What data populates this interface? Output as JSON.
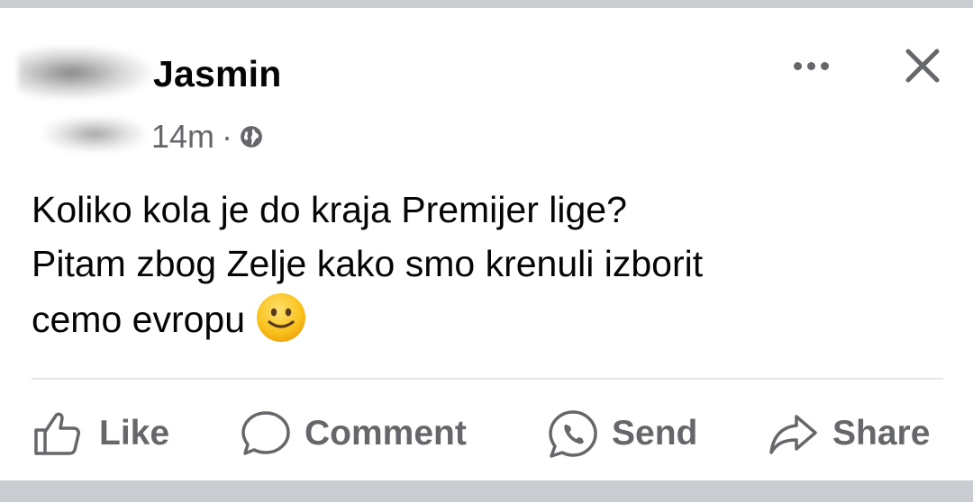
{
  "post": {
    "author_name": "Jasmin",
    "time": "14m",
    "separator": "·",
    "privacy_icon": "globe-icon",
    "text_lines": [
      "Koliko kola je do kraja Premijer lige?",
      "Pitam zbog Zelje kako smo krenuli izborit",
      "cemo evropu"
    ],
    "emoji": "slightly-smiling-face-icon"
  },
  "header_actions": {
    "more_icon": "more-options-icon",
    "close_icon": "close-icon"
  },
  "actions": {
    "like_label": "Like",
    "comment_label": "Comment",
    "send_label": "Send",
    "share_label": "Share"
  },
  "colors": {
    "page_bg": "#c9ccd1",
    "card_bg": "#ffffff",
    "text_primary": "#050505",
    "text_secondary": "#65676b",
    "divider": "#e4e6eb"
  }
}
